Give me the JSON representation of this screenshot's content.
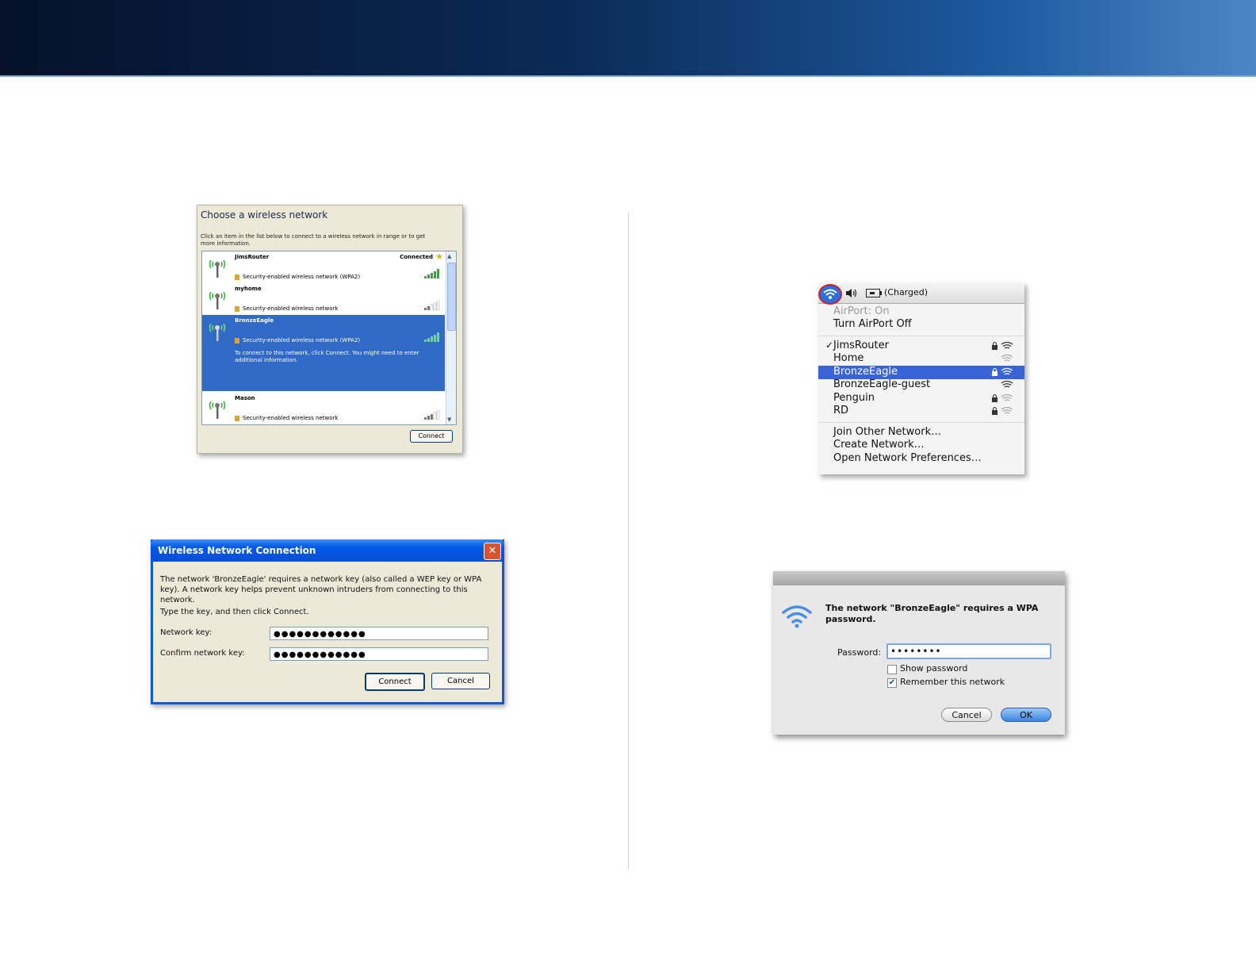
{
  "xp_choose": {
    "title": "Choose a wireless network",
    "description": "Click an item in the list below to connect to a wireless network in range or to get more information.",
    "networks": [
      {
        "name": "JimsRouter",
        "security": "Security-enabled wireless network (WPA2)",
        "status": "Connected"
      },
      {
        "name": "myhome",
        "security": "Security-enabled wireless network"
      },
      {
        "name": "BronzeEagle",
        "security": "Security-enabled wireless network (WPA2)",
        "info": "To connect to this network, click Connect. You might need to enter additional information."
      },
      {
        "name": "Mason",
        "security": "Security-enabled wireless network"
      }
    ],
    "connect_label": "Connect"
  },
  "xp_dialog": {
    "title": "Wireless Network Connection",
    "message": "The network 'BronzeEagle' requires a network key (also called a WEP key or WPA key). A network key helps prevent unknown intruders from connecting to this network.",
    "instruction": "Type the key, and then click Connect.",
    "key_label": "Network key:",
    "key_value": "●●●●●●●●●●●●",
    "confirm_label": "Confirm network key:",
    "confirm_value": "●●●●●●●●●●●●",
    "connect_label": "Connect",
    "cancel_label": "Cancel"
  },
  "mac_menu": {
    "battery_status": "(Charged)",
    "airport_status": "AirPort: On",
    "turn_off": "Turn AirPort Off",
    "networks": [
      {
        "name": "JimsRouter",
        "checked": true,
        "locked": true
      },
      {
        "name": "Home",
        "checked": false,
        "locked": false
      },
      {
        "name": "BronzeEagle",
        "checked": false,
        "locked": true,
        "highlighted": true
      },
      {
        "name": "BronzeEagle-guest",
        "checked": false,
        "locked": false
      },
      {
        "name": "Penguin",
        "checked": false,
        "locked": true
      },
      {
        "name": "RD",
        "checked": false,
        "locked": true
      }
    ],
    "check_mark": "✓",
    "join_other": "Join Other Network…",
    "create": "Create Network…",
    "open_prefs": "Open Network Preferences…"
  },
  "mac_dialog": {
    "message": "The network \"BronzeEagle\" requires a WPA password.",
    "password_label": "Password:",
    "password_value": "••••••••",
    "show_password": "Show password",
    "remember": "Remember this network",
    "remember_checked": true,
    "cancel_label": "Cancel",
    "ok_label": "OK"
  }
}
